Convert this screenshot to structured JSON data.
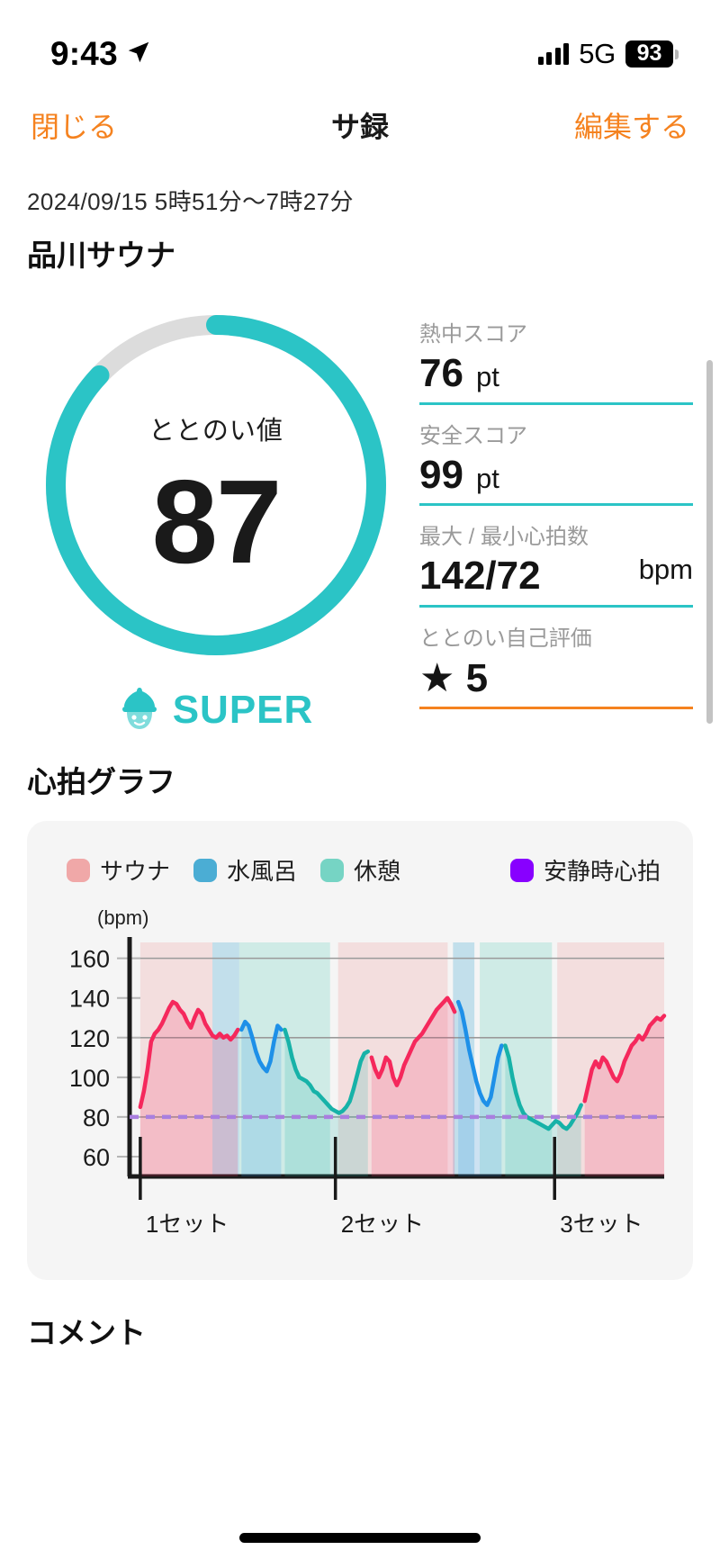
{
  "status_bar": {
    "time": "9:43",
    "location_icon": "location-arrow-icon",
    "signal_icon": "cellular-signal-icon",
    "network": "5G",
    "battery_level": "93"
  },
  "nav_bar": {
    "close_label": "閉じる",
    "title": "サ録",
    "edit_label": "編集する",
    "accent_color": "#F5821F"
  },
  "session": {
    "date_time": "2024/09/15 5時51分〜7時27分",
    "venue": "品川サウナ"
  },
  "score_ring": {
    "label": "ととのい値",
    "value": "87",
    "percent": 87,
    "ring_color": "#2BC4C6",
    "track_color": "#DCDCDC",
    "badge_label": "SUPER",
    "badge_icon": "sauna-hat-character-icon",
    "badge_color": "#2BC4C6"
  },
  "stats": [
    {
      "label": "熱中スコア",
      "value": "76",
      "unit": "pt",
      "rule_color": "#2BC4C6"
    },
    {
      "label": "安全スコア",
      "value": "99",
      "unit": "pt",
      "rule_color": "#2BC4C6"
    },
    {
      "label": "最大 / 最小心拍数",
      "value": "142/72",
      "unit": "bpm",
      "rule_color": "#2BC4C6"
    },
    {
      "label": "ととのい自己評価",
      "value": "★ 5",
      "unit": "",
      "rule_color": "#F5821F"
    }
  ],
  "chart_section": {
    "title": "心拍グラフ"
  },
  "comment_section": {
    "title": "コメント"
  },
  "chart_data": {
    "type": "line",
    "title": "心拍グラフ",
    "unit_label": "(bpm)",
    "ylabel": "bpm",
    "xlabel": "",
    "ylim": [
      50,
      168
    ],
    "yticks": [
      160,
      140,
      120,
      100,
      80,
      60
    ],
    "gridlines": [
      160,
      120,
      80
    ],
    "grid": true,
    "legend_position": "top",
    "legend": [
      {
        "name": "サウナ",
        "color": "#F0A8A8"
      },
      {
        "name": "水風呂",
        "color": "#4BADD4"
      },
      {
        "name": "休憩",
        "color": "#76D4C4"
      },
      {
        "name": "安静時心拍",
        "color": "#8800FF"
      }
    ],
    "xticks": [
      {
        "label": "1セット",
        "pos": 0.02
      },
      {
        "label": "2セット",
        "pos": 0.385
      },
      {
        "label": "3セット",
        "pos": 0.795
      }
    ],
    "resting_hr": 80,
    "resting_hr_color": "#A97FE0",
    "bands": [
      {
        "phase": "サウナ",
        "start": 0.02,
        "end": 0.155,
        "color": "#F0A8A8"
      },
      {
        "phase": "水風呂",
        "start": 0.155,
        "end": 0.205,
        "color": "#4BADD4"
      },
      {
        "phase": "休憩",
        "start": 0.205,
        "end": 0.375,
        "color": "#76D4C4"
      },
      {
        "phase": "サウナ",
        "start": 0.39,
        "end": 0.595,
        "color": "#F0A8A8"
      },
      {
        "phase": "水風呂",
        "start": 0.605,
        "end": 0.645,
        "color": "#4BADD4"
      },
      {
        "phase": "休憩",
        "start": 0.655,
        "end": 0.79,
        "color": "#76D4C4"
      },
      {
        "phase": "サウナ",
        "start": 0.8,
        "end": 1.0,
        "color": "#F0A8A8"
      }
    ],
    "series": [
      {
        "name": "サウナ",
        "color": "#F5285C",
        "values": [
          85,
          93,
          104,
          118,
          122,
          124,
          127,
          131,
          135,
          138,
          137,
          134,
          132,
          128,
          125,
          130,
          134,
          132,
          127,
          124,
          121,
          120,
          122,
          120,
          121,
          119,
          121,
          124
        ]
      },
      {
        "name": "水風呂",
        "color": "#1E90E8",
        "values": [
          124,
          128,
          126,
          120,
          113,
          108,
          105,
          103,
          108,
          118,
          126,
          124
        ]
      },
      {
        "name": "休憩",
        "color": "#17B2A8",
        "values": [
          124,
          118,
          110,
          104,
          100,
          99,
          98,
          96,
          93,
          92,
          90,
          88,
          86,
          84,
          83,
          82,
          83,
          85,
          88,
          94,
          101,
          108,
          112,
          113
        ]
      },
      {
        "name": "サウナ2",
        "color": "#F5285C",
        "values": [
          110,
          104,
          100,
          104,
          110,
          108,
          100,
          96,
          100,
          106,
          110,
          114,
          118,
          120,
          122,
          125,
          128,
          131,
          134,
          136,
          138,
          140,
          137,
          133
        ]
      },
      {
        "name": "水風呂2",
        "color": "#1E90E8",
        "values": [
          138,
          133,
          124,
          114,
          106,
          98,
          92,
          88,
          86,
          90,
          100,
          110,
          116
        ]
      },
      {
        "name": "休憩2",
        "color": "#17B2A8",
        "values": [
          116,
          110,
          100,
          92,
          86,
          82,
          80,
          79,
          78,
          77,
          76,
          75,
          74,
          76,
          78,
          77,
          75,
          74,
          76,
          79,
          82,
          86
        ]
      },
      {
        "name": "サウナ3",
        "color": "#F5285C",
        "values": [
          88,
          96,
          104,
          108,
          105,
          110,
          108,
          104,
          100,
          98,
          102,
          108,
          112,
          116,
          118,
          121,
          119,
          122,
          126,
          128,
          130,
          129,
          131
        ]
      }
    ]
  }
}
